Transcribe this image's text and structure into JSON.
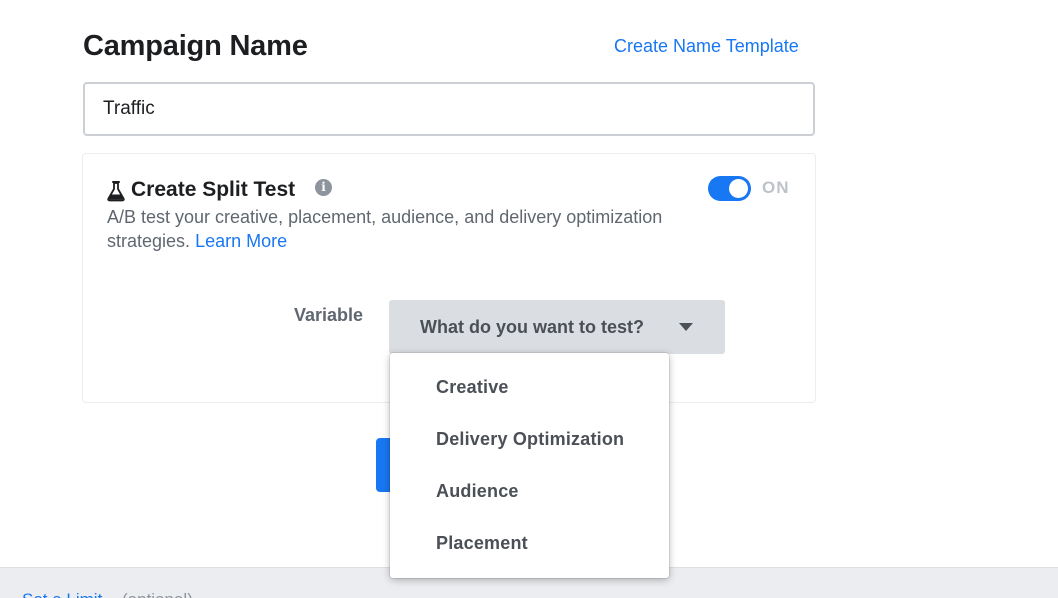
{
  "campaign": {
    "title": "Campaign Name",
    "name_template_link": "Create Name Template",
    "name_value": "Traffic"
  },
  "split_test": {
    "title": "Create Split Test",
    "description": "A/B test your creative, placement, audience, and delivery optimization strategies.",
    "learn_more": "Learn More",
    "toggle_state": "ON",
    "variable_label": "Variable",
    "variable_placeholder": "What do you want to test?",
    "options": [
      "Creative",
      "Delivery Optimization",
      "Audience",
      "Placement"
    ]
  },
  "bottom": {
    "set_limit": "Set a Limit",
    "optional": "(optional)"
  },
  "colors": {
    "accent": "#1877f2",
    "toggle_off_label": "#bec3c9",
    "select_bg": "#dadde1"
  },
  "icons": {
    "flask": "flask-icon",
    "info": "info-icon",
    "caret": "caret-down-icon"
  }
}
